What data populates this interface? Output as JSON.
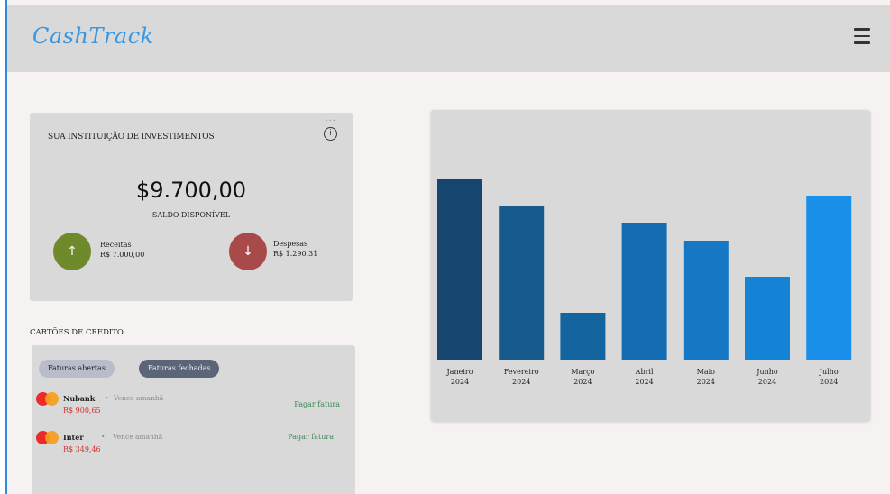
{
  "app": {
    "logo": "CashTrack",
    "menu_icon": "hamburger-menu-icon"
  },
  "investment": {
    "title": "SUA INSTITUIÇÃO DE INVESTIMENTOS",
    "menu_dots": "...",
    "info_icon": "info-icon",
    "info_glyph": "i",
    "balance": "$9.700,00",
    "balance_label": "SALDO DISPONÍVEL",
    "income": {
      "label": "Receitas",
      "value": "R$ 7.000,00",
      "icon": "arrow-up-icon",
      "glyph": "↑",
      "color": "#6f8a2b"
    },
    "expense": {
      "label": "Despesas",
      "value": "R$ 1.290,31",
      "icon": "arrow-down-icon",
      "glyph": "↓",
      "color": "#a84a4a"
    }
  },
  "credit_cards": {
    "title": "CARTÕES DE CREDITO",
    "tabs": [
      {
        "label": "Faturas abertas"
      },
      {
        "label": "Faturas fechadas"
      }
    ],
    "cards": [
      {
        "name": "Nubank",
        "separator": "•",
        "due": "Vence amanhã",
        "amount": "R$ 900,65",
        "action": "Pagar fatura",
        "icon": "mastercard-icon"
      },
      {
        "name": "Inter",
        "separator": "•",
        "due": "Vence amanhã",
        "amount": "R$ 349,46",
        "action": "Pagar fatura",
        "icon": "mastercard-icon"
      }
    ]
  },
  "chart_data": {
    "type": "bar",
    "categories": [
      [
        "Janeiro",
        "2024"
      ],
      [
        "Fevereiro",
        "2024"
      ],
      [
        "Março",
        "2024"
      ],
      [
        "Abril",
        "2024"
      ],
      [
        "Maio",
        "2024"
      ],
      [
        "Junho",
        "2024"
      ],
      [
        "Julho",
        "2024"
      ]
    ],
    "values": [
      100,
      85,
      26,
      76,
      66,
      46,
      91
    ],
    "colors": [
      "#16466f",
      "#175a8e",
      "#1464a0",
      "#146db2",
      "#1678c4",
      "#1583d6",
      "#1a90ea"
    ],
    "ylim": [
      0,
      100
    ]
  }
}
